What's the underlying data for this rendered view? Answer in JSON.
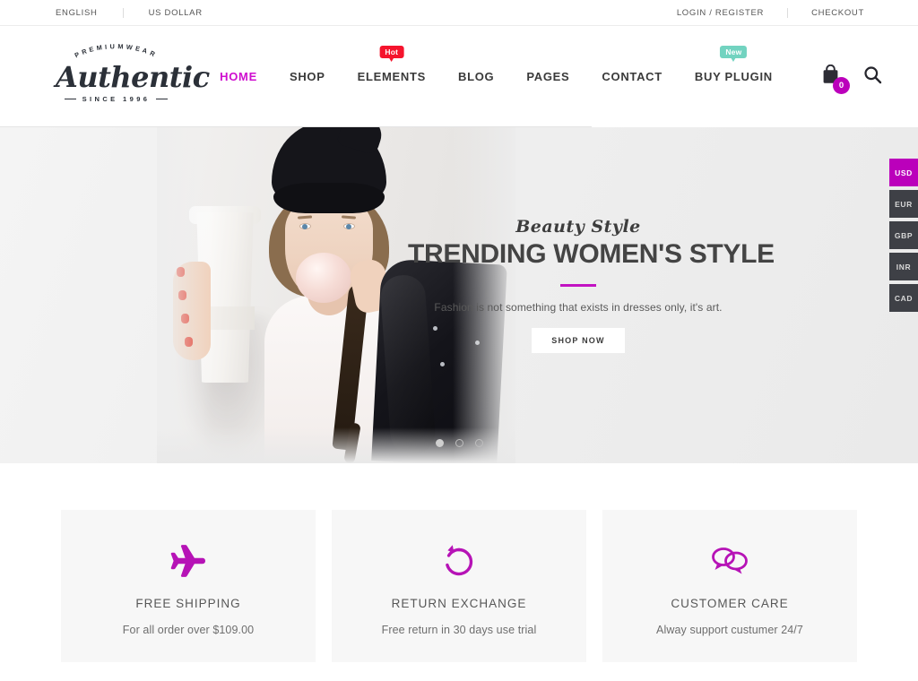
{
  "topbar": {
    "language": "ENGLISH",
    "currency": "US DOLLAR",
    "login": "LOGIN / REGISTER",
    "checkout": "CHECKOUT"
  },
  "logo": {
    "arc": "PREMIUMWEAR",
    "name": "Authentic",
    "since": "SINCE 1996"
  },
  "nav": {
    "items": [
      {
        "label": "HOME",
        "active": true,
        "badge": null
      },
      {
        "label": "SHOP",
        "active": false,
        "badge": null
      },
      {
        "label": "ELEMENTS",
        "active": false,
        "badge": "Hot",
        "badge_type": "hot"
      },
      {
        "label": "BLOG",
        "active": false,
        "badge": null
      },
      {
        "label": "PAGES",
        "active": false,
        "badge": null
      },
      {
        "label": "CONTACT",
        "active": false,
        "badge": null
      },
      {
        "label": "BUY PLUGIN",
        "active": false,
        "badge": "New",
        "badge_type": "new"
      }
    ],
    "cart_icon": "shopping-bag-icon",
    "cart_count": "0",
    "search_icon": "search-icon"
  },
  "hero": {
    "script_title": "Beauty Style",
    "title": "TRENDING WOMEN'S STYLE",
    "subtitle": "Fashion is not something that exists in dresses only, it's art.",
    "cta": "SHOP NOW",
    "dots": [
      {
        "active": true
      },
      {
        "active": false
      },
      {
        "active": false
      }
    ]
  },
  "currency_switcher": {
    "items": [
      {
        "code": "USD",
        "active": true
      },
      {
        "code": "EUR",
        "active": false
      },
      {
        "code": "GBP",
        "active": false
      },
      {
        "code": "INR",
        "active": false
      },
      {
        "code": "CAD",
        "active": false
      }
    ]
  },
  "features": [
    {
      "icon": "airplane-icon",
      "title": "FREE SHIPPING",
      "desc": "For all order over $109.00"
    },
    {
      "icon": "return-arrow-icon",
      "title": "RETURN EXCHANGE",
      "desc": "Free return in 30 days use trial"
    },
    {
      "icon": "chat-bubbles-icon",
      "title": "CUSTOMER CARE",
      "desc": "Alway support custumer 24/7"
    }
  ],
  "colors": {
    "accent": "#cf0ecf",
    "accent_dark": "#bb00bb",
    "hot_badge": "#f5142d",
    "new_badge": "#72d3c0",
    "text_dark": "#2b3038",
    "feature_bg": "#f7f7f7"
  }
}
